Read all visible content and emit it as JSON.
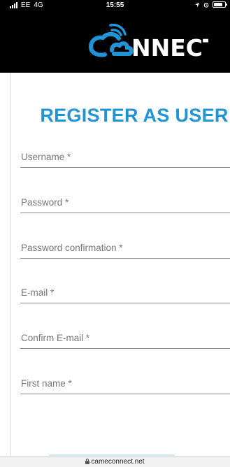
{
  "status_bar": {
    "carrier": "EE",
    "network": "4G",
    "time": "15:55"
  },
  "brand": {
    "logo_text": "NNECT",
    "accent_color": "#1f95d8"
  },
  "page": {
    "title": "REGISTER AS USER"
  },
  "form": {
    "fields": [
      {
        "label": "Username *"
      },
      {
        "label": "Password *"
      },
      {
        "label": "Password confirmation *"
      },
      {
        "label": "E-mail *"
      },
      {
        "label": "Confirm E-mail *"
      },
      {
        "label": "First name *"
      }
    ]
  },
  "browser": {
    "url": "cameconnect.net"
  }
}
